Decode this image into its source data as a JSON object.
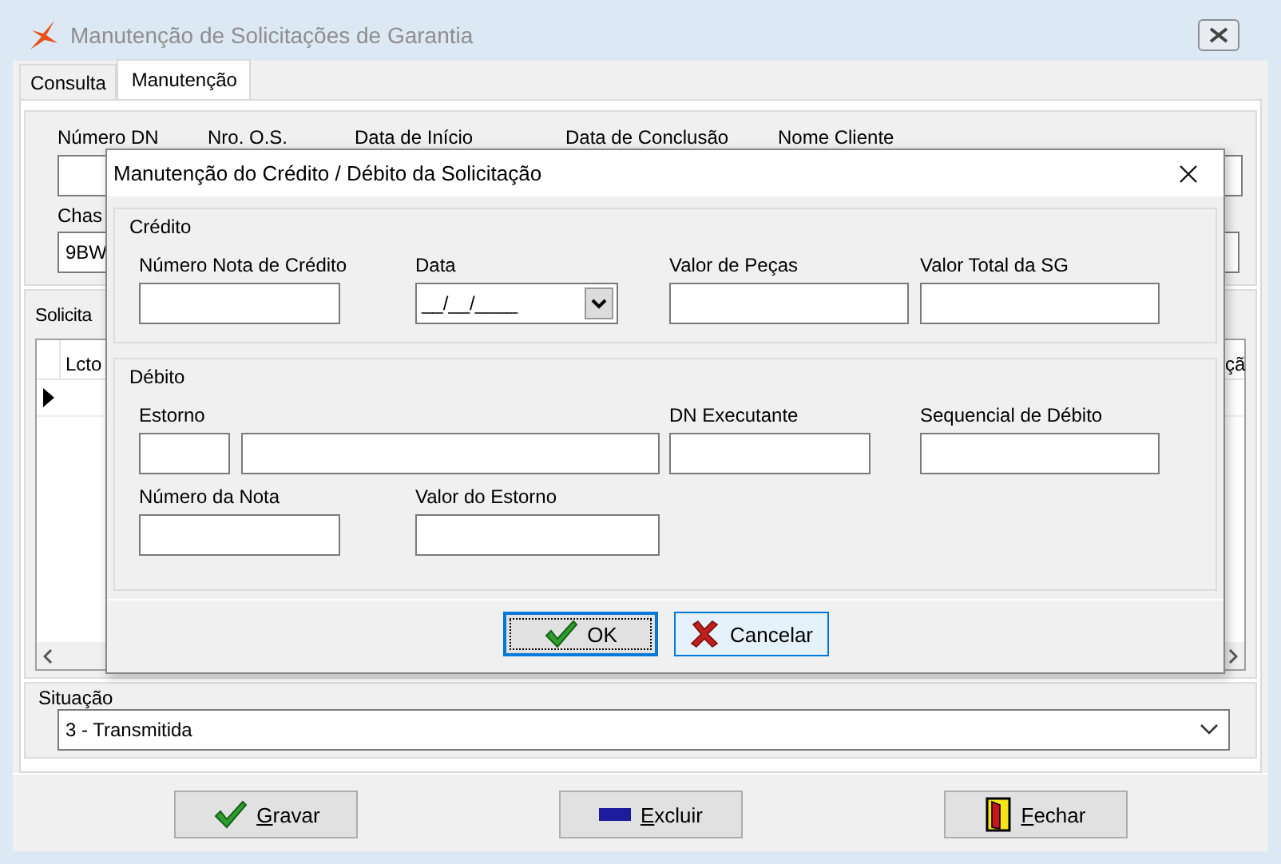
{
  "window": {
    "title": "Manutenção de Solicitações de Garantia"
  },
  "tabs": [
    {
      "label": "Consulta",
      "selected": false
    },
    {
      "label": "Manutenção",
      "selected": true
    }
  ],
  "header_fields": [
    "Número DN",
    "Nro. O.S.",
    "Data de Início",
    "Data de Conclusão",
    "Nome Cliente"
  ],
  "chassis": {
    "label": "Chas",
    "value": "9BW"
  },
  "requests": {
    "title": "Solicita",
    "columns": [
      "Lcto",
      "çã"
    ]
  },
  "status": {
    "label": "Situação",
    "value": "3 - Transmitida"
  },
  "buttons": [
    {
      "label": "Gravar",
      "kind": "check",
      "underline_first": true
    },
    {
      "label": "Excluir",
      "kind": "minus",
      "underline_first": true
    },
    {
      "label": "Fechar",
      "kind": "door",
      "underline_first": true
    }
  ],
  "dialog": {
    "title": "Manutenção do Crédito / Débito da Solicitação",
    "groups": [
      {
        "title": "Crédito",
        "fields": [
          {
            "label": "Número Nota de Crédito",
            "kind": "text"
          },
          {
            "label": "Data",
            "kind": "date",
            "value": "__/__/____"
          },
          {
            "label": "Valor de Peças",
            "kind": "text"
          },
          {
            "label": "Valor Total da SG",
            "kind": "text"
          }
        ]
      },
      {
        "title": "Débito",
        "fields": [
          {
            "label": "Estorno",
            "kind": "pair"
          },
          {
            "label": "DN Executante",
            "kind": "text"
          },
          {
            "label": "Sequencial de Débito",
            "kind": "text"
          },
          {
            "label": "Número da Nota",
            "kind": "text"
          },
          {
            "label": "Valor do Estorno",
            "kind": "text"
          }
        ]
      }
    ],
    "buttons": [
      {
        "label": "OK",
        "kind": "check",
        "focused": true
      },
      {
        "label": "Cancelar",
        "kind": "cross",
        "focused": false
      }
    ]
  }
}
